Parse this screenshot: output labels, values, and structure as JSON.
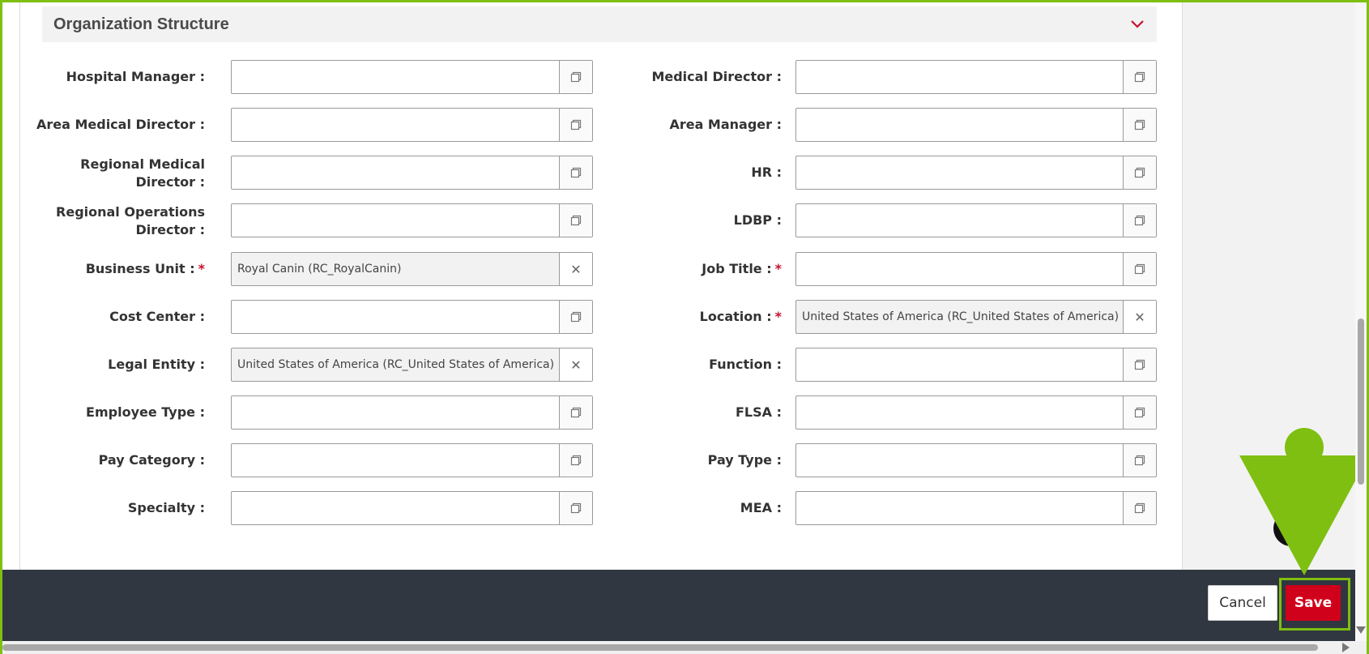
{
  "section": {
    "title": "Organization Structure",
    "chevron_icon": "chevron-down-icon",
    "accent": "#c8102e"
  },
  "left_fields": [
    {
      "label": "Hospital Manager :",
      "value": "",
      "required": false,
      "action_icon": "copy-icon"
    },
    {
      "label": "Area Medical Director :",
      "value": "",
      "required": false,
      "action_icon": "copy-icon"
    },
    {
      "label": "Regional Medical Director :",
      "value": "",
      "required": false,
      "action_icon": "copy-icon"
    },
    {
      "label": "Regional Operations Director :",
      "value": "",
      "required": false,
      "action_icon": "copy-icon"
    },
    {
      "label": "Business Unit :",
      "value": "Royal Canin (RC_RoyalCanin)",
      "required": true,
      "action_icon": "clear-icon"
    },
    {
      "label": "Cost Center :",
      "value": "",
      "required": false,
      "action_icon": "copy-icon"
    },
    {
      "label": "Legal Entity :",
      "value": "United States of America (RC_United States of America)",
      "required": false,
      "action_icon": "clear-icon"
    },
    {
      "label": "Employee Type :",
      "value": "",
      "required": false,
      "action_icon": "copy-icon"
    },
    {
      "label": "Pay Category :",
      "value": "",
      "required": false,
      "action_icon": "copy-icon"
    },
    {
      "label": "Specialty :",
      "value": "",
      "required": false,
      "action_icon": "copy-icon"
    }
  ],
  "right_fields": [
    {
      "label": "Medical Director :",
      "value": "",
      "required": false,
      "action_icon": "copy-icon"
    },
    {
      "label": "Area Manager :",
      "value": "",
      "required": false,
      "action_icon": "copy-icon"
    },
    {
      "label": "HR :",
      "value": "",
      "required": false,
      "action_icon": "copy-icon"
    },
    {
      "label": "LDBP :",
      "value": "",
      "required": false,
      "action_icon": "copy-icon"
    },
    {
      "label": "Job Title :",
      "value": "",
      "required": true,
      "action_icon": "copy-icon"
    },
    {
      "label": "Location :",
      "value": "United States of America (RC_United States of America)",
      "required": true,
      "action_icon": "clear-icon"
    },
    {
      "label": "Function :",
      "value": "",
      "required": false,
      "action_icon": "copy-icon"
    },
    {
      "label": "FLSA :",
      "value": "",
      "required": false,
      "action_icon": "copy-icon"
    },
    {
      "label": "Pay Type :",
      "value": "",
      "required": false,
      "action_icon": "copy-icon"
    },
    {
      "label": "MEA :",
      "value": "",
      "required": false,
      "action_icon": "copy-icon"
    }
  ],
  "required_marker": "*",
  "clear_glyph": "✕",
  "footer": {
    "cancel_label": "Cancel",
    "save_label": "Save",
    "save_color": "#d0021b",
    "highlight_color": "#7fbf11"
  }
}
